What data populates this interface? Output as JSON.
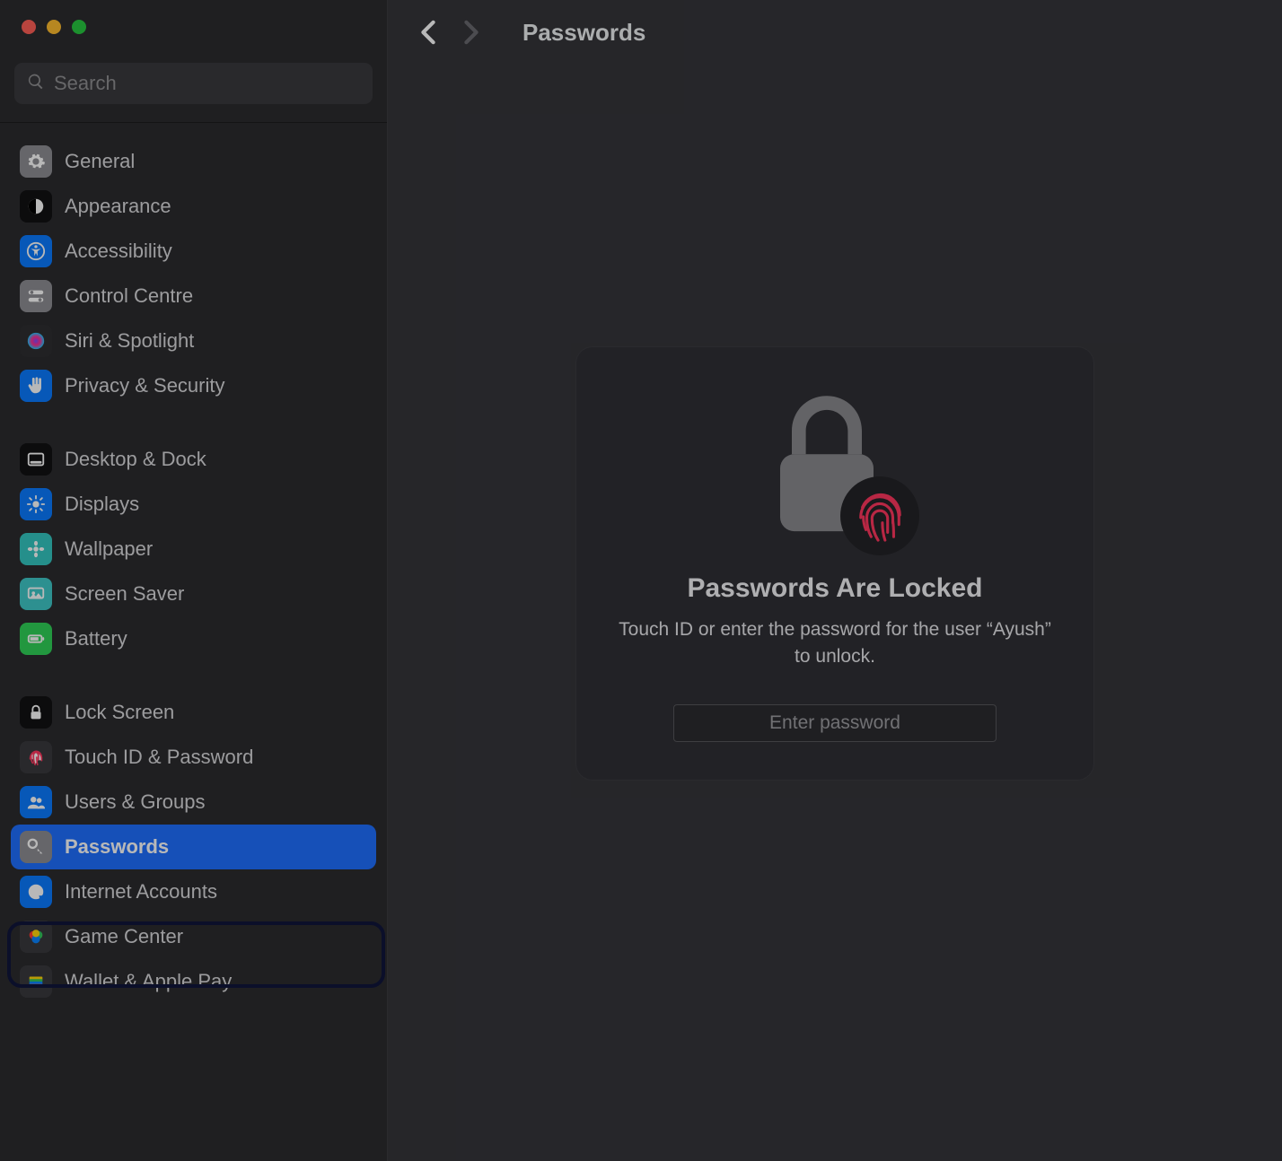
{
  "window": {
    "traffic": [
      "close",
      "minimize",
      "zoom"
    ]
  },
  "sidebar": {
    "search_placeholder": "Search",
    "groups": [
      {
        "items": [
          {
            "id": "general",
            "label": "General",
            "icon": "gear-icon",
            "bg": "#8e8e93"
          },
          {
            "id": "appearance",
            "label": "Appearance",
            "icon": "contrast-icon",
            "bg": "#111112"
          },
          {
            "id": "accessibility",
            "label": "Accessibility",
            "icon": "accessibility-icon",
            "bg": "#0a7aff"
          },
          {
            "id": "control-centre",
            "label": "Control Centre",
            "icon": "switches-icon",
            "bg": "#8e8e93"
          },
          {
            "id": "siri-spotlight",
            "label": "Siri & Spotlight",
            "icon": "siri-icon",
            "bg": "#2e2e31"
          },
          {
            "id": "privacy-security",
            "label": "Privacy & Security",
            "icon": "hand-icon",
            "bg": "#0a7aff"
          }
        ]
      },
      {
        "items": [
          {
            "id": "desktop-dock",
            "label": "Desktop & Dock",
            "icon": "dock-icon",
            "bg": "#111112"
          },
          {
            "id": "displays",
            "label": "Displays",
            "icon": "sun-icon",
            "bg": "#0a7aff"
          },
          {
            "id": "wallpaper",
            "label": "Wallpaper",
            "icon": "flower-icon",
            "bg": "#34c7c1"
          },
          {
            "id": "screen-saver",
            "label": "Screen Saver",
            "icon": "screensaver-icon",
            "bg": "#3fc8c8"
          },
          {
            "id": "battery",
            "label": "Battery",
            "icon": "battery-icon",
            "bg": "#30d158"
          }
        ]
      },
      {
        "items": [
          {
            "id": "lock-screen",
            "label": "Lock Screen",
            "icon": "lockscreen-icon",
            "bg": "#111112"
          },
          {
            "id": "touchid-password",
            "label": "Touch ID & Password",
            "icon": "fingerprint-icon",
            "bg": "#3a3a3e"
          },
          {
            "id": "users-groups",
            "label": "Users & Groups",
            "icon": "users-icon",
            "bg": "#0a7aff"
          },
          {
            "id": "passwords",
            "label": "Passwords",
            "icon": "key-icon",
            "bg": "#8e8e93",
            "selected": true
          },
          {
            "id": "internet-accounts",
            "label": "Internet Accounts",
            "icon": "at-icon",
            "bg": "#0a7aff"
          },
          {
            "id": "game-center",
            "label": "Game Center",
            "icon": "gamecenter-icon",
            "bg": "#3a3a3e"
          },
          {
            "id": "wallet-applepay",
            "label": "Wallet & Apple Pay",
            "icon": "wallet-icon",
            "bg": "#3a3a3e"
          }
        ]
      }
    ]
  },
  "main": {
    "title": "Passwords",
    "nav": {
      "back_enabled": true,
      "forward_enabled": false
    },
    "lock": {
      "title": "Passwords Are Locked",
      "subtitle": "Touch ID or enter the password for the user “Ayush” to unlock.",
      "placeholder": "Enter password"
    }
  }
}
